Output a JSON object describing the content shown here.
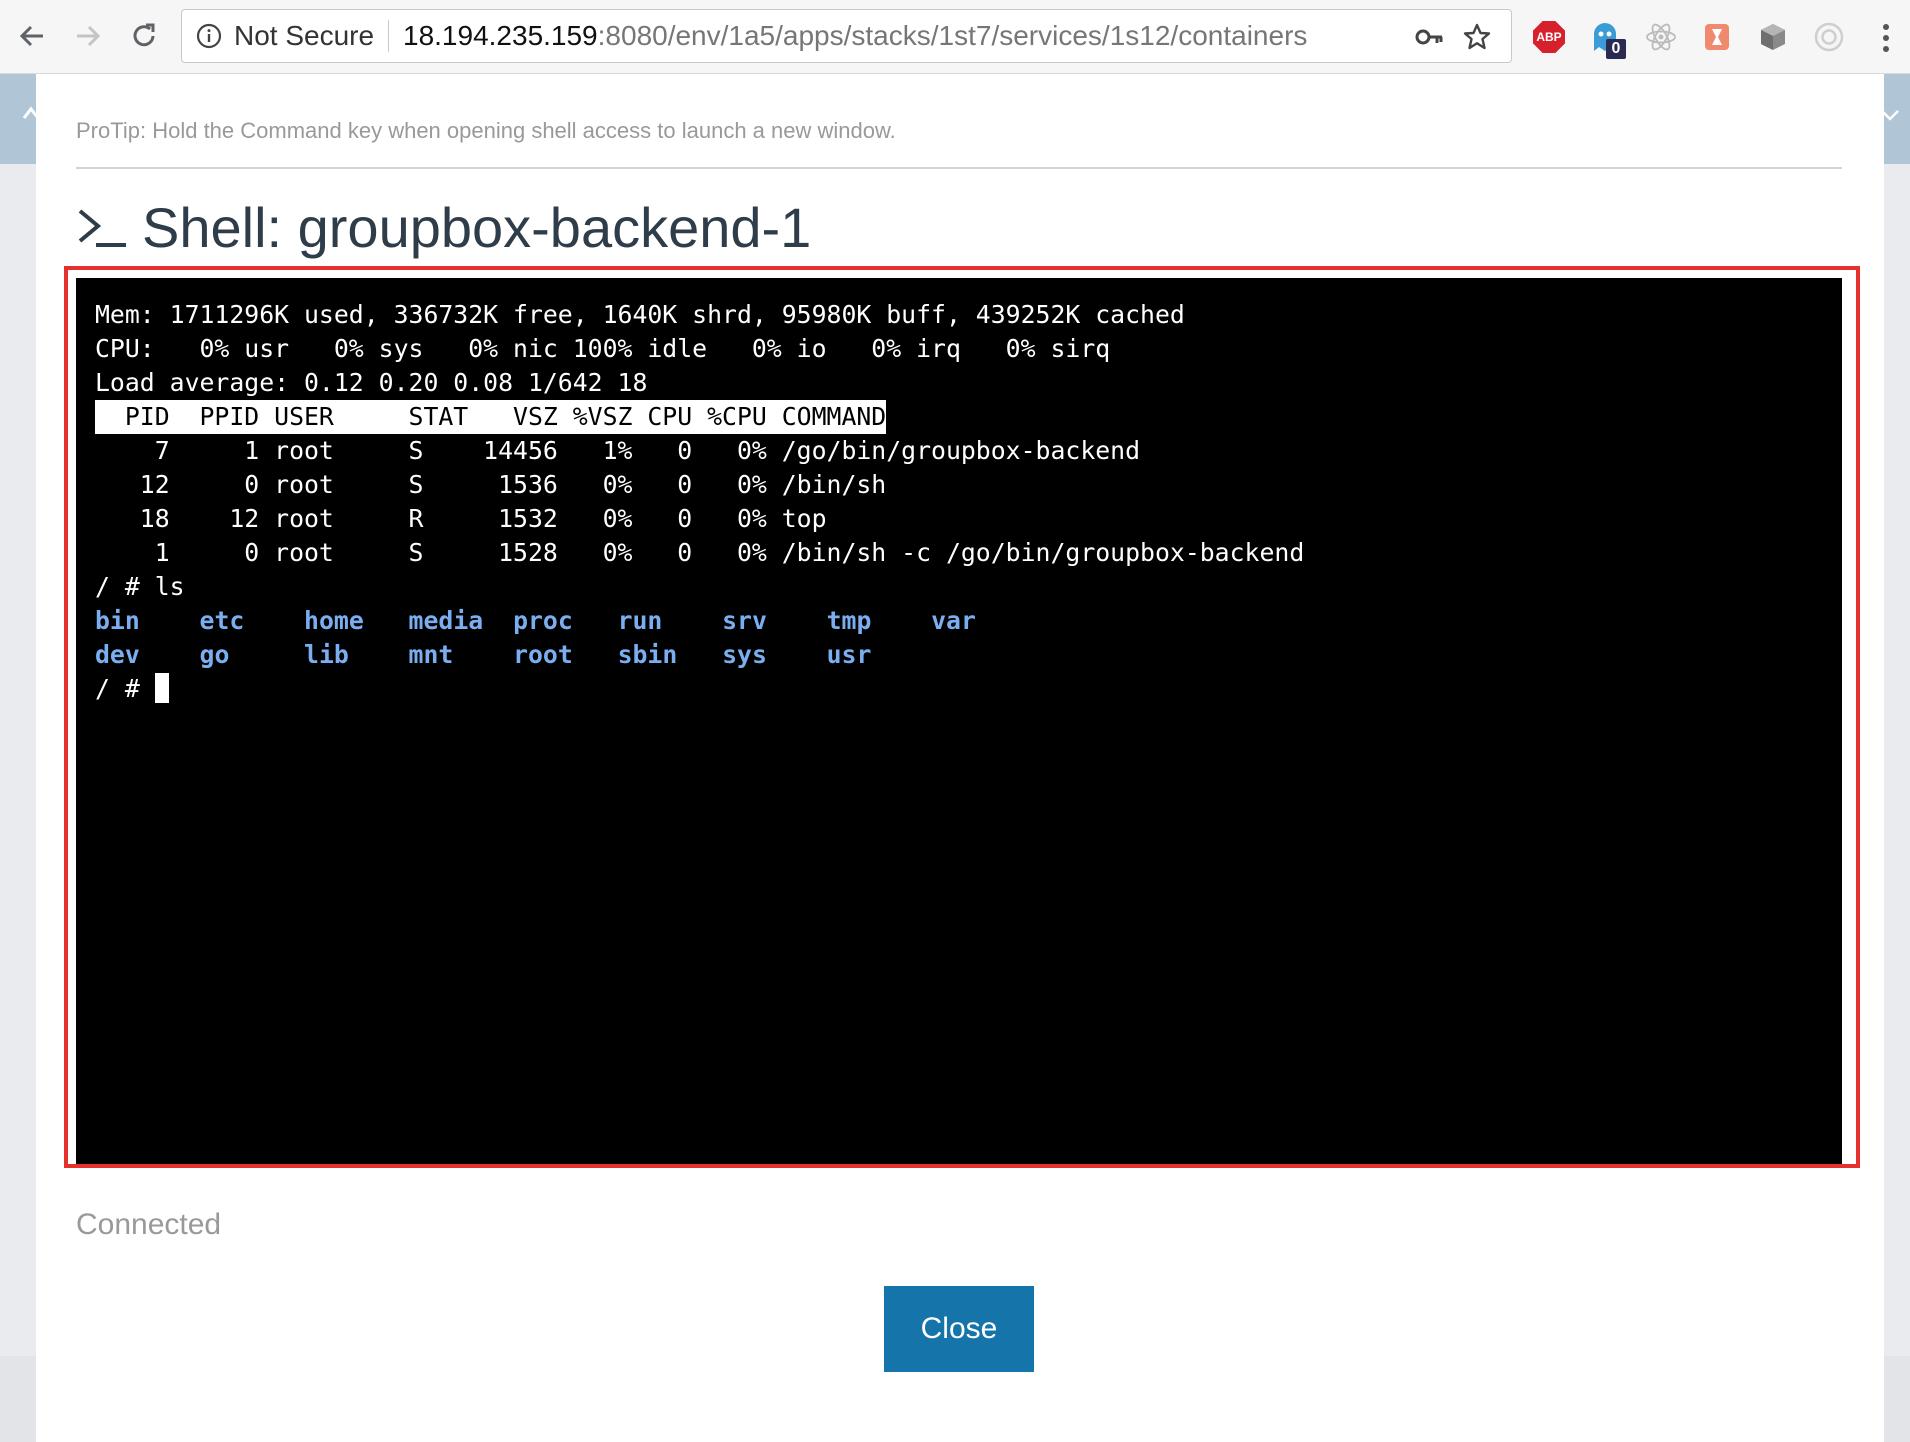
{
  "browser": {
    "security_label": "Not Secure",
    "url_host": "18.194.235.159",
    "url_path": ":8080/env/1a5/apps/stacks/1st7/services/1s12/containers",
    "extensions": [
      {
        "name": "adblock-plus-icon",
        "label": "ABP",
        "color": "#d6202b"
      },
      {
        "name": "ghostery-icon",
        "badge": "0"
      },
      {
        "name": "react-devtools-icon"
      },
      {
        "name": "extension-icon"
      },
      {
        "name": "cube-icon"
      },
      {
        "name": "camera-icon"
      }
    ]
  },
  "modal": {
    "protip": "ProTip: Hold the Command key when opening shell access to launch a new window.",
    "title": "Shell: groupbox-backend-1",
    "status": "Connected",
    "close_label": "Close",
    "accent_color": "#1575ab",
    "highlight_color": "#e5302c"
  },
  "terminal": {
    "lines": [
      "Mem: 1711296K used, 336732K free, 1640K shrd, 95980K buff, 439252K cached",
      "CPU:   0% usr   0% sys   0% nic 100% idle   0% io   0% irq   0% sirq",
      "Load average: 0.12 0.20 0.08 1/642 18"
    ],
    "process_header": "  PID  PPID USER     STAT   VSZ %VSZ CPU %CPU COMMAND",
    "processes": [
      "    7     1 root     S    14456   1%   0   0% /go/bin/groupbox-backend",
      "   12     0 root     S     1536   0%   0   0% /bin/sh",
      "   18    12 root     R     1532   0%   0   0% top",
      "    1     0 root     S     1528   0%   0   0% /bin/sh -c /go/bin/groupbox-backend"
    ],
    "command_line": "/ # ls",
    "ls_rows": [
      [
        "bin",
        "etc",
        "home",
        "media",
        "proc",
        "run",
        "srv",
        "tmp",
        "var"
      ],
      [
        "dev",
        "go",
        "lib",
        "mnt",
        "root",
        "sbin",
        "sys",
        "usr"
      ]
    ],
    "prompt": "/ # "
  }
}
